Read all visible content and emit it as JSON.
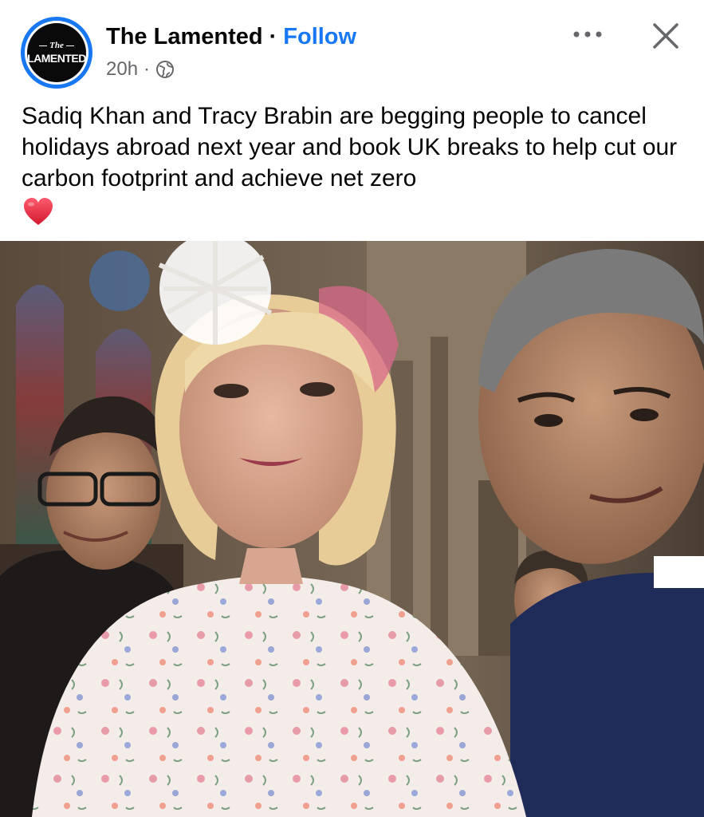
{
  "post": {
    "page_name": "The Lamented",
    "separator": "·",
    "follow_label": "Follow",
    "time": "20h",
    "meta_separator": "·",
    "privacy_icon": "globe-icon",
    "more_icon": "more-horizontal-icon",
    "close_icon": "close-icon",
    "avatar": {
      "small_text": "The",
      "big_text": "LAMENTED",
      "ring_color": "#1877f2"
    },
    "text": "Sadiq Khan and Tracy Brabin are begging people to cancel holidays abroad next year and book UK breaks to help cut our carbon footprint and achieve net zero",
    "emoji_icon": "red-heart-icon",
    "photo": {
      "description_icon": "photo",
      "alt": ""
    }
  },
  "colors": {
    "accent": "#1877f2",
    "text": "#050505",
    "secondary": "#65676b",
    "heart": "#e0203a"
  }
}
